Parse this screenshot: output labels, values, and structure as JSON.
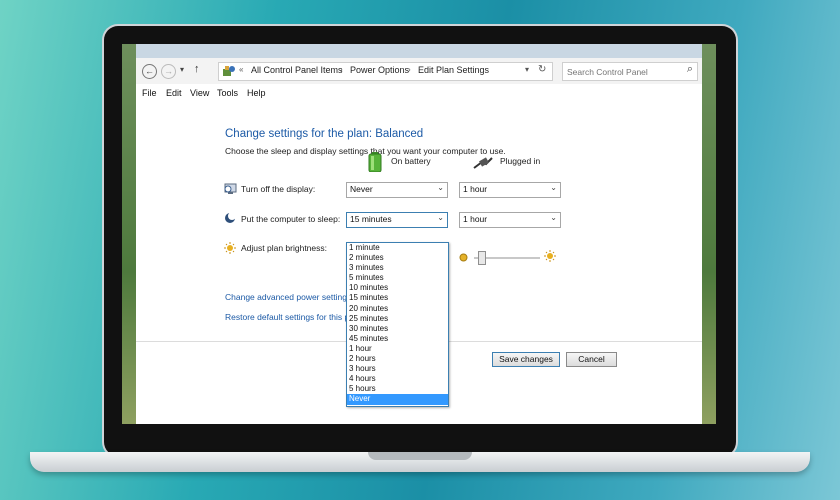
{
  "window": {
    "nav": {
      "back": "←",
      "forward": "→",
      "down": "▾",
      "up": "↑"
    },
    "breadcrumb": {
      "overflow": "«",
      "items": [
        "All Control Panel Items",
        "Power Options",
        "Edit Plan Settings"
      ],
      "separator": "›",
      "dropdown": "▾",
      "refresh": "↻"
    },
    "search": {
      "placeholder": "Search Control Panel",
      "icon": "⌕"
    },
    "menu": [
      "File",
      "Edit",
      "View",
      "Tools",
      "Help"
    ]
  },
  "content": {
    "title": "Change settings for the plan: Balanced",
    "subtitle": "Choose the sleep and display settings that you want your computer to use.",
    "columns": {
      "battery": "On battery",
      "plugged": "Plugged in"
    },
    "rows": {
      "display": {
        "label": "Turn off the display:",
        "battery": "Never",
        "plugged": "1 hour"
      },
      "sleep": {
        "label": "Put the computer to sleep:",
        "battery": "15 minutes",
        "plugged": "1 hour"
      },
      "brightness": {
        "label": "Adjust plan brightness:",
        "plugged_level": 0.0
      }
    },
    "sleep_dropdown_options": [
      "1 minute",
      "2 minutes",
      "3 minutes",
      "5 minutes",
      "10 minutes",
      "15 minutes",
      "20 minutes",
      "25 minutes",
      "30 minutes",
      "45 minutes",
      "1 hour",
      "2 hours",
      "3 hours",
      "4 hours",
      "5 hours",
      "Never"
    ],
    "sleep_dropdown_highlighted": "Never",
    "links": {
      "advanced": "Change advanced power settings",
      "restore": "Restore default settings for this pla"
    },
    "buttons": {
      "save": "Save changes",
      "cancel": "Cancel"
    },
    "chevron": "⌄"
  },
  "colors": {
    "link": "#1c5aa6",
    "highlight": "#3399ff"
  }
}
